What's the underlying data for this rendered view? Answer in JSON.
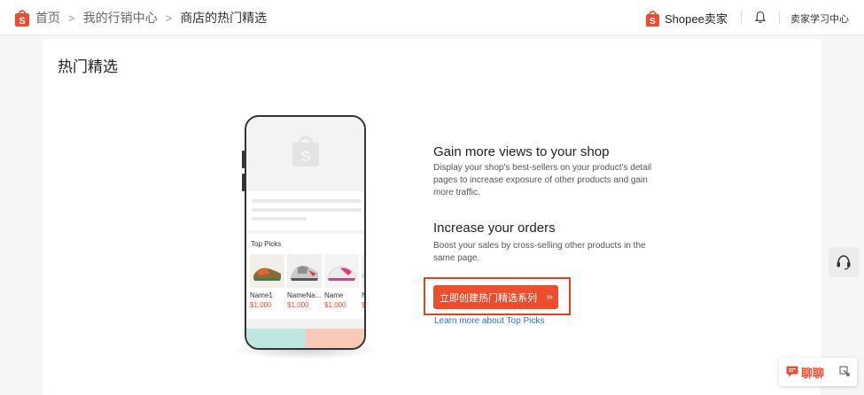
{
  "topbar": {
    "breadcrumb": [
      "首页",
      "我的行销中心",
      "商店的热门精选"
    ],
    "separator": ">",
    "seller_label": "Shopee卖家",
    "learning_center": "卖家学习中心"
  },
  "page": {
    "title": "热门精选"
  },
  "phone": {
    "picks_title": "Top Picks",
    "items": [
      {
        "name": "Name1",
        "price": "$1,000"
      },
      {
        "name": "NameNa...",
        "price": "$1,000"
      },
      {
        "name": "Name",
        "price": "$1,000"
      },
      {
        "name": "N",
        "price": "$"
      }
    ]
  },
  "benefits": [
    {
      "title": "Gain more views to your shop",
      "body": "Display your shop's best-sellers on your product's detail pages to increase exposure of other products and gain more traffic."
    },
    {
      "title": "Increase your orders",
      "body": "Boost your sales by cross-selling other products in the same page."
    }
  ],
  "cta": {
    "label": "立即创建热门精选系列",
    "arrows": "›››"
  },
  "learn_more": "Learn more about Top Picks",
  "chat": {
    "label": "聊聊"
  },
  "colors": {
    "brand": "#ee4d2d",
    "highlight_border": "#e8401e",
    "link": "#2673dd"
  },
  "icons": {
    "brand": "shopee-bag-icon",
    "bell": "bell-icon",
    "support": "headset-icon",
    "chat": "chat-bubble-icon",
    "minimize": "minimize-icon"
  }
}
